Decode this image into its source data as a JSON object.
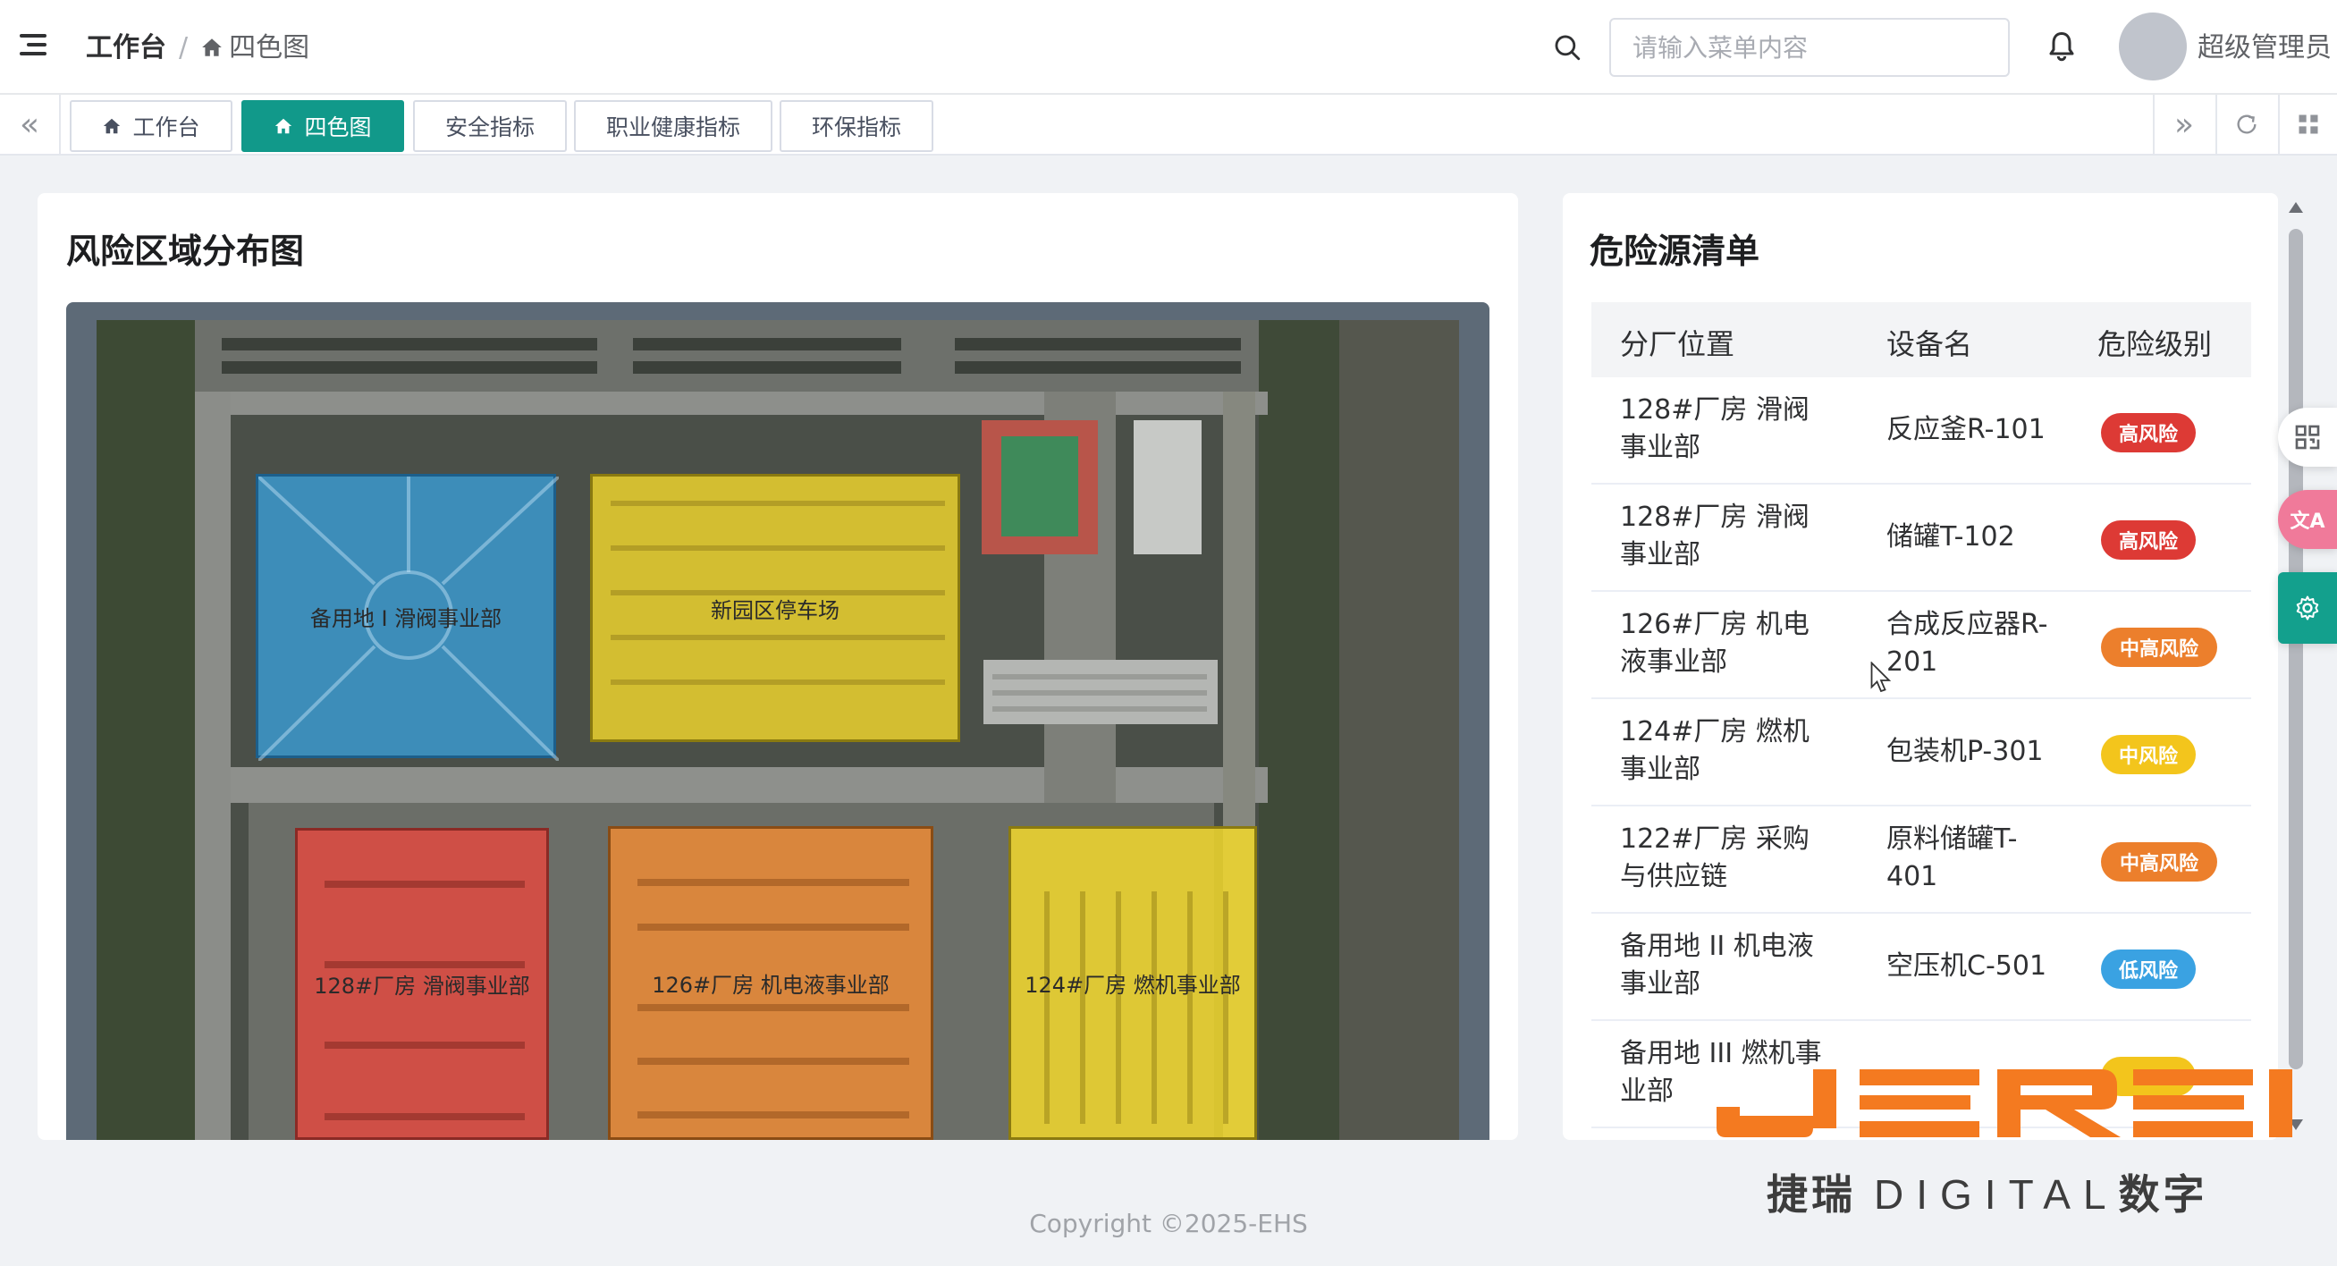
{
  "header": {
    "breadcrumb": [
      "工作台",
      "四色图"
    ],
    "search_placeholder": "请输入菜单内容",
    "username": "超级管理员"
  },
  "tags": [
    {
      "label": "工作台",
      "active": false,
      "icon": "home-icon"
    },
    {
      "label": "四色图",
      "active": true,
      "icon": "home-icon"
    },
    {
      "label": "安全指标",
      "active": false
    },
    {
      "label": "职业健康指标",
      "active": false
    },
    {
      "label": "环保指标",
      "active": false
    }
  ],
  "map_panel": {
    "title": "风险区域分布图",
    "zones": [
      {
        "label": "备用地 I 滑阀事业部",
        "risk_color": "#3a9fd8"
      },
      {
        "label": "新园区停车场",
        "risk_color": "#f1d72c"
      },
      {
        "label": "128#厂房 滑阀事业部",
        "risk_color": "#e04a41"
      },
      {
        "label": "126#厂房 机电液事业部",
        "risk_color": "#eb8a35"
      },
      {
        "label": "124#厂房 燃机事业部",
        "risk_color": "#f1d72c"
      }
    ]
  },
  "hazard_panel": {
    "title": "危险源清单",
    "columns": [
      "分厂位置",
      "设备名",
      "危险级别"
    ],
    "rows": [
      {
        "location": "128#厂房 滑阀事业部",
        "device": "反应釜R-101",
        "level": "高风险",
        "color": "#dd3a35"
      },
      {
        "location": "128#厂房 滑阀事业部",
        "device": "储罐T-102",
        "level": "高风险",
        "color": "#dd3a35"
      },
      {
        "location": "126#厂房 机电液事业部",
        "device": "合成反应器R-201",
        "level": "中高风险",
        "color": "#ec7f2c"
      },
      {
        "location": "124#厂房 燃机事业部",
        "device": "包装机P-301",
        "level": "中风险",
        "color": "#f3c51c"
      },
      {
        "location": "122#厂房 采购与供应链",
        "device": "原料储罐T-401",
        "level": "中高风险",
        "color": "#ec7f2c"
      },
      {
        "location": "备用地 II 机电液事业部",
        "device": "空压机C-501",
        "level": "低风险",
        "color": "#3aa2e2"
      },
      {
        "location": "备用地 III 燃机事业部",
        "device": "",
        "level": "",
        "color": "#f3c51c"
      }
    ]
  },
  "footer": {
    "copyright": "Copyright ©2025-EHS"
  },
  "watermark": {
    "brand": "JEREI",
    "subtitle_cn_1": "捷瑞",
    "subtitle_en": "DIGITAL",
    "subtitle_cn_2": "数字",
    "color": "#f47a20"
  },
  "floating": {
    "lang_label": "文A"
  }
}
